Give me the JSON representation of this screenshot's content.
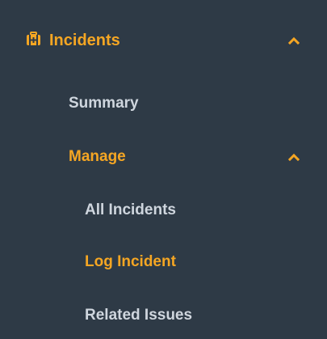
{
  "nav": {
    "section": {
      "label": "Incidents",
      "icon": "first-aid-kit-icon",
      "expanded": true
    },
    "items": [
      {
        "label": "Summary",
        "state": "normal"
      },
      {
        "label": "Manage",
        "state": "active",
        "expanded": true
      }
    ],
    "subitems": [
      {
        "label": "All Incidents",
        "state": "normal"
      },
      {
        "label": "Log Incident",
        "state": "active"
      },
      {
        "label": "Related Issues",
        "state": "normal"
      }
    ]
  },
  "colors": {
    "background": "#2e3a46",
    "accent": "#f5a623",
    "text_muted": "#cfd6de"
  }
}
